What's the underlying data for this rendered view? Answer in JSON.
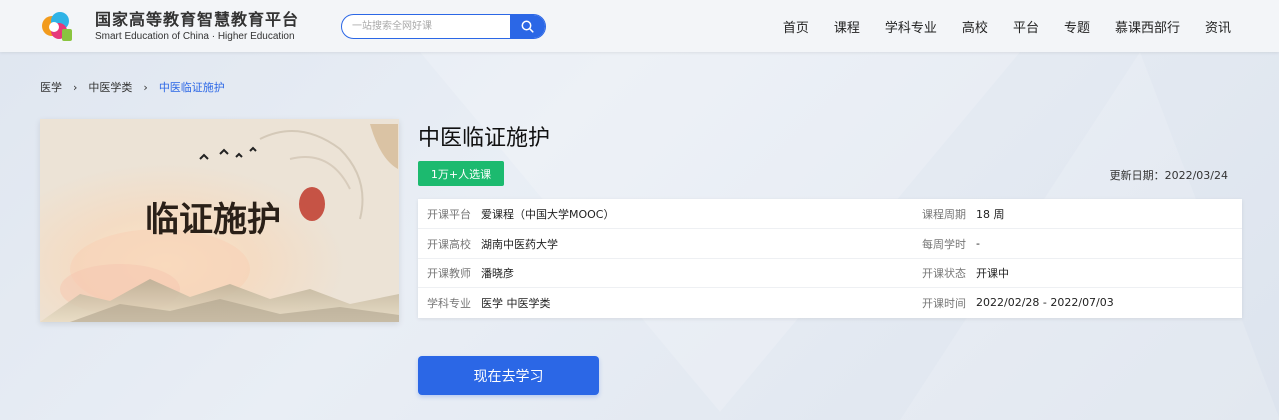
{
  "header": {
    "logo_cn": "国家高等教育智慧教育平台",
    "logo_en": "Smart Education of China · Higher Education",
    "search_placeholder": "一站搜索全网好课",
    "nav": [
      "首页",
      "课程",
      "学科专业",
      "高校",
      "平台",
      "专题",
      "慕课西部行",
      "资讯"
    ]
  },
  "breadcrumb": {
    "items": [
      "医学",
      "中医学类",
      "中医临证施护"
    ],
    "separator": "›"
  },
  "course": {
    "title": "中医临证施护",
    "cover_title": "临证施护",
    "enroll_badge": "1万+人选课",
    "update_label": "更新日期：",
    "update_date": "2022/03/24",
    "study_button": "现在去学习"
  },
  "info": {
    "left": [
      {
        "label": "开课平台",
        "value": "爱课程（中国大学MOOC）"
      },
      {
        "label": "开课高校",
        "value": "湖南中医药大学"
      },
      {
        "label": "开课教师",
        "value": "潘晓彦"
      },
      {
        "label": "学科专业",
        "value": "医学 中医学类"
      }
    ],
    "right": [
      {
        "label": "课程周期",
        "value": "18 周"
      },
      {
        "label": "每周学时",
        "value": "-"
      },
      {
        "label": "开课状态",
        "value": "开课中"
      },
      {
        "label": "开课时间",
        "value": "2022/02/28 - 2022/07/03"
      }
    ]
  },
  "colors": {
    "accent": "#2b67e6",
    "badge_green": "#1cba6f"
  }
}
